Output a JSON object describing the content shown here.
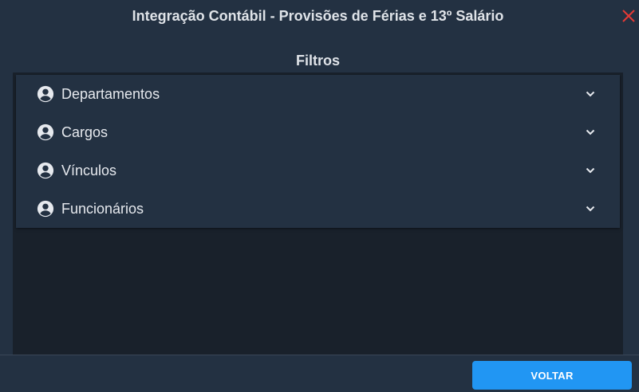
{
  "dialog": {
    "title": "Integração Contábil - Provisões de Férias e 13º Salário",
    "close_icon": "close-icon",
    "close_color": "#e53935"
  },
  "filters": {
    "heading": "Filtros",
    "items": [
      {
        "label": "Departamentos",
        "icon": "person-circle-icon"
      },
      {
        "label": "Cargos",
        "icon": "person-circle-icon"
      },
      {
        "label": "Vínculos",
        "icon": "person-circle-icon"
      },
      {
        "label": "Funcionários",
        "icon": "person-circle-icon"
      }
    ]
  },
  "footer": {
    "back_label": "VOLTAR",
    "accent": "#2196f3"
  }
}
